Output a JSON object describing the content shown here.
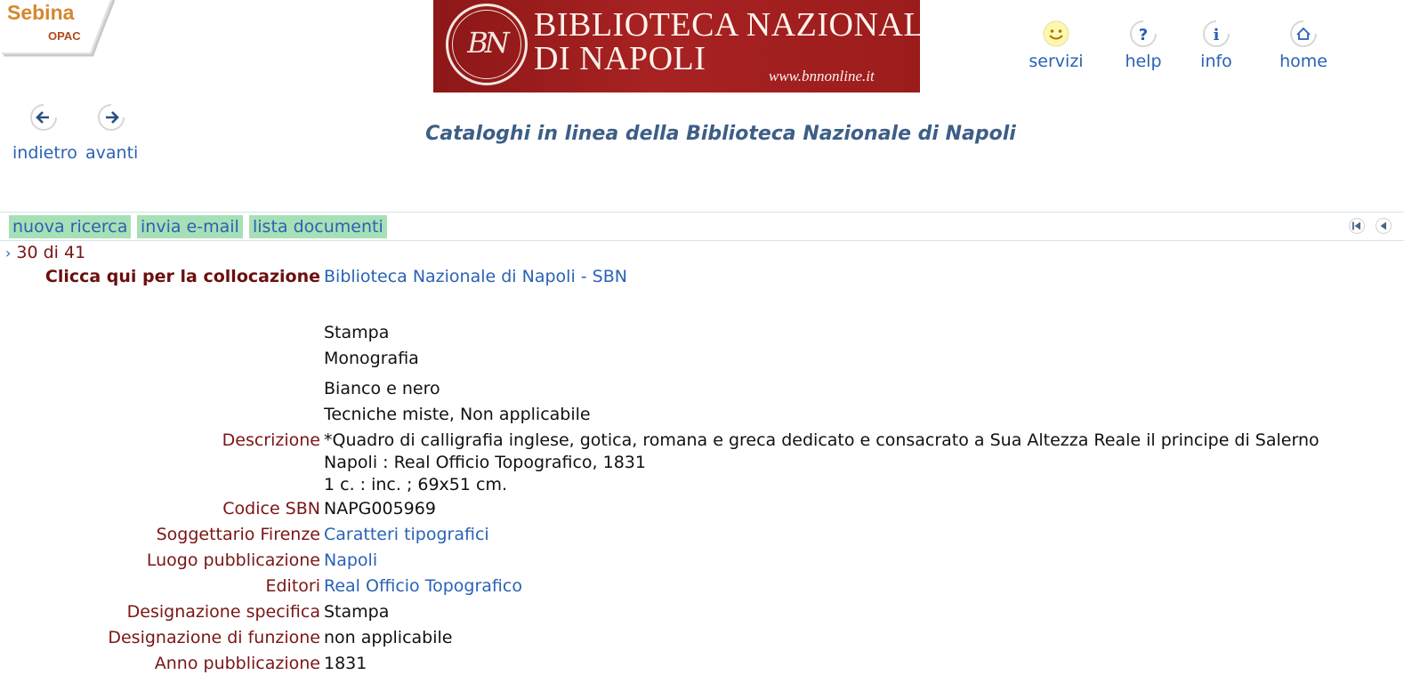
{
  "logo": {
    "name": "Sebina",
    "sub": "OPAC"
  },
  "banner": {
    "seal_text": "BN",
    "line1": "BIBLIOTECA NAZIONALE",
    "line2": "DI NAPOLI",
    "url": "www.bnnonline.it"
  },
  "topnav": [
    {
      "label": "servizi",
      "icon": "smiley-icon"
    },
    {
      "label": "help",
      "icon": "question-icon"
    },
    {
      "label": "info",
      "icon": "info-icon"
    },
    {
      "label": "home",
      "icon": "home-icon"
    }
  ],
  "history": {
    "back_label": "indietro",
    "forward_label": "avanti"
  },
  "page_title": "Cataloghi in linea della Biblioteca Nazionale di Napoli",
  "toolbar": {
    "new_search": "nuova ricerca",
    "send_email": "invia e-mail",
    "doc_list": "lista documenti"
  },
  "record": {
    "count": "30 di 41",
    "collocation_label": "Clicca qui per la collocazione",
    "collocation_value": "Biblioteca Nazionale di Napoli - SBN",
    "type_lines": [
      "Stampa",
      "Monografia"
    ],
    "tech_lines": [
      "Bianco e nero",
      "Tecniche miste, Non applicabile"
    ],
    "fields": {
      "descrizione_label": "Descrizione",
      "descrizione_lines": [
        "*Quadro di calligrafia inglese, gotica, romana e greca dedicato e consacrato a Sua Altezza Reale il principe di Salerno",
        "Napoli : Real Officio Topografico, 1831",
        "1 c. : inc. ; 69x51 cm."
      ],
      "codice_label": "Codice SBN",
      "codice_value": "NAPG005969",
      "soggettario_label": "Soggettario Firenze",
      "soggettario_value": "Caratteri tipografici",
      "luogo_label": "Luogo pubblicazione",
      "luogo_value": "Napoli",
      "editori_label": "Editori",
      "editori_value": "Real Officio Topografico",
      "desig_spec_label": "Designazione specifica",
      "desig_spec_value": "Stampa",
      "desig_funz_label": "Designazione di funzione",
      "desig_funz_value": "non applicabile",
      "anno_label": "Anno pubblicazione",
      "anno_value": "1831"
    }
  },
  "colors": {
    "link": "#2a62b5",
    "label": "#7a1515",
    "button_bg": "#a7e0b6",
    "banner": "#a01d1d",
    "title": "#3d5e86"
  }
}
